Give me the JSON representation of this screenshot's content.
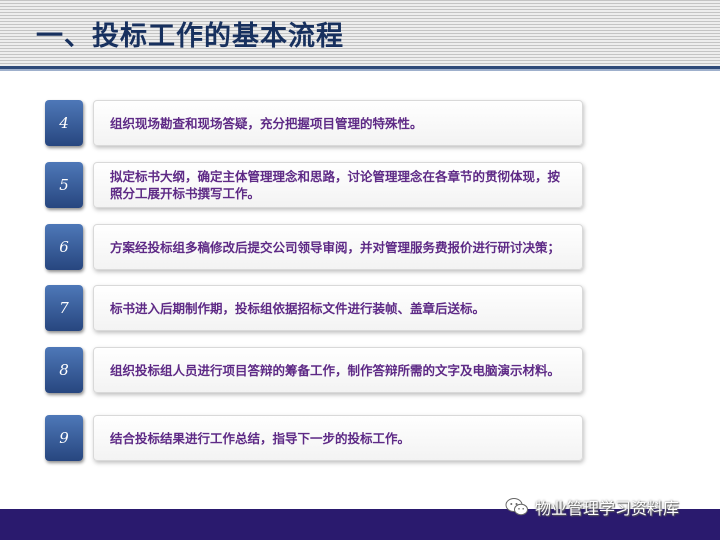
{
  "slide": {
    "title": "一、投标工作的基本流程"
  },
  "steps": [
    {
      "number": "4",
      "text": "组织现场勘查和现场答疑，充分把握项目管理的特殊性。"
    },
    {
      "number": "5",
      "text": "拟定标书大纲，确定主体管理理念和思路，讨论管理理念在各章节的贯彻体现，按照分工展开标书撰写工作。"
    },
    {
      "number": "6",
      "text": "方案经投标组多稿修改后提交公司领导审阅，并对管理服务费报价进行研讨决策；"
    },
    {
      "number": "7",
      "text": "标书进入后期制作期，投标组依据招标文件进行装帧、盖章后送标。"
    },
    {
      "number": "8",
      "text": "组织投标组人员进行项目答辩的筹备工作，制作答辩所需的文字及电脑演示材料。"
    },
    {
      "number": "9",
      "text": "结合投标结果进行工作总结，指导下一步的投标工作。"
    }
  ],
  "watermark": {
    "icon": "wechat-icon",
    "text": "物业管理学习资料库"
  },
  "colors": {
    "title": "#17305e",
    "number_badge": "#27467f",
    "step_text": "#5e2a86",
    "footer": "#2a1a6e"
  }
}
